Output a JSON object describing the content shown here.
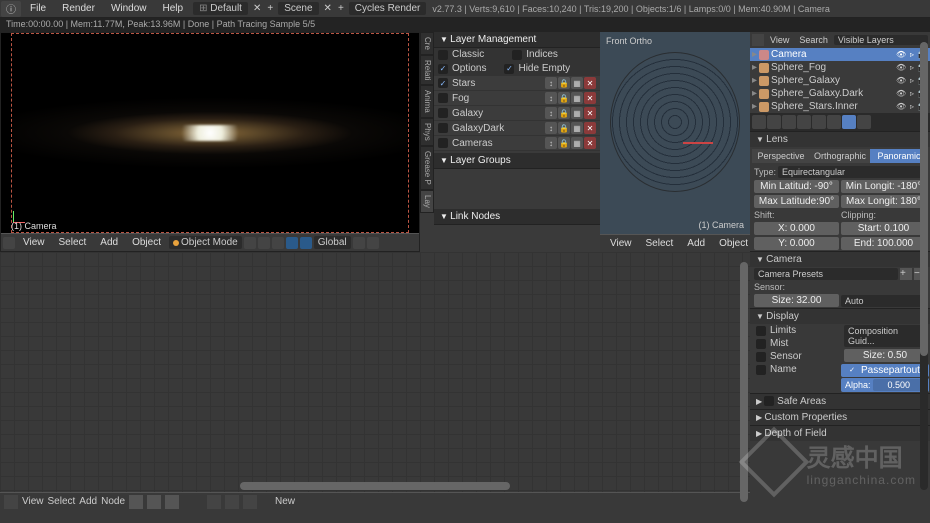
{
  "menubar": {
    "items": [
      "File",
      "Render",
      "Window",
      "Help"
    ],
    "layout": "Default",
    "scene": "Scene",
    "engine": "Cycles Render",
    "stats": "v2.77.3 | Verts:9,610 | Faces:10,240 | Tris:19,200 | Objects:1/6 | Lamps:0/0 | Mem:40.90M | Camera"
  },
  "status": "Time:00:00.00 | Mem:11.77M, Peak:13.96M | Done | Path Tracing Sample 5/5",
  "vp_left": {
    "camera": "(1) Camera"
  },
  "vp_header": {
    "items": [
      "View",
      "Select",
      "Add",
      "Object"
    ],
    "mode": "Object Mode",
    "orientation": "Global"
  },
  "layer_panel": {
    "title": "Layer Management",
    "tabs": [
      "Lay",
      "Grease P",
      "Phys",
      "Anima",
      "Relati",
      "Cre"
    ],
    "classic": "Classic",
    "indices": "Indices",
    "options": "Options",
    "hide_empty": "Hide Empty",
    "layers": [
      {
        "name": "Stars",
        "on": true
      },
      {
        "name": "Fog",
        "on": false
      },
      {
        "name": "Galaxy",
        "on": false
      },
      {
        "name": "GalaxyDark",
        "on": false
      },
      {
        "name": "Cameras",
        "on": false
      }
    ],
    "groups": "Layer Groups",
    "link": "Link Nodes"
  },
  "vp_mid3d": {
    "label": "Front Ortho",
    "camera": "(1) Camera"
  },
  "outliner": {
    "header": [
      "View",
      "Search",
      "Visible Layers"
    ],
    "items": [
      {
        "name": "Camera",
        "type": "camera",
        "active": true
      },
      {
        "name": "Sphere_Fog",
        "type": "mesh"
      },
      {
        "name": "Sphere_Galaxy",
        "type": "mesh"
      },
      {
        "name": "Sphere_Galaxy.Dark",
        "type": "mesh"
      },
      {
        "name": "Sphere_Stars.Inner",
        "type": "mesh"
      }
    ]
  },
  "props": {
    "lens_title": "Lens",
    "lens_tabs": [
      "Perspective",
      "Orthographic",
      "Panoramic"
    ],
    "type_label": "Type:",
    "type_value": "Equirectangular",
    "min_lat_label": "Min Latitud:",
    "min_lat": "-90°",
    "max_lat_label": "Max Latitude:",
    "max_lat": "90°",
    "min_lon_label": "Min Longit:",
    "min_lon": "-180°",
    "max_lon_label": "Max Longit:",
    "max_lon": "180°",
    "shift_label": "Shift:",
    "clip_label": "Clipping:",
    "x_label": "X:",
    "x": "0.000",
    "y_label": "Y:",
    "y": "0.000",
    "start_label": "Start:",
    "start": "0.100",
    "end_label": "End:",
    "end": "100.000",
    "camera_title": "Camera",
    "presets_title": "Camera Presets",
    "sensor_label": "Sensor:",
    "size_label": "Size:",
    "size": "32.00",
    "auto": "Auto",
    "display_title": "Display",
    "limits": "Limits",
    "mist": "Mist",
    "sensor": "Sensor",
    "name": "Name",
    "comp_guides": "Composition Guid...",
    "disp_size_label": "Size:",
    "disp_size": "0.50",
    "passepartout": "Passepartout",
    "alpha_label": "Alpha:",
    "alpha": "0.500",
    "safe_areas": "Safe Areas",
    "custom_props": "Custom Properties",
    "dof": "Depth of Field"
  },
  "node_header": {
    "items": [
      "View",
      "Select",
      "Add",
      "Node"
    ],
    "new": "New"
  },
  "watermark": {
    "cn": "灵感中国",
    "en": "lingganchina.com"
  }
}
